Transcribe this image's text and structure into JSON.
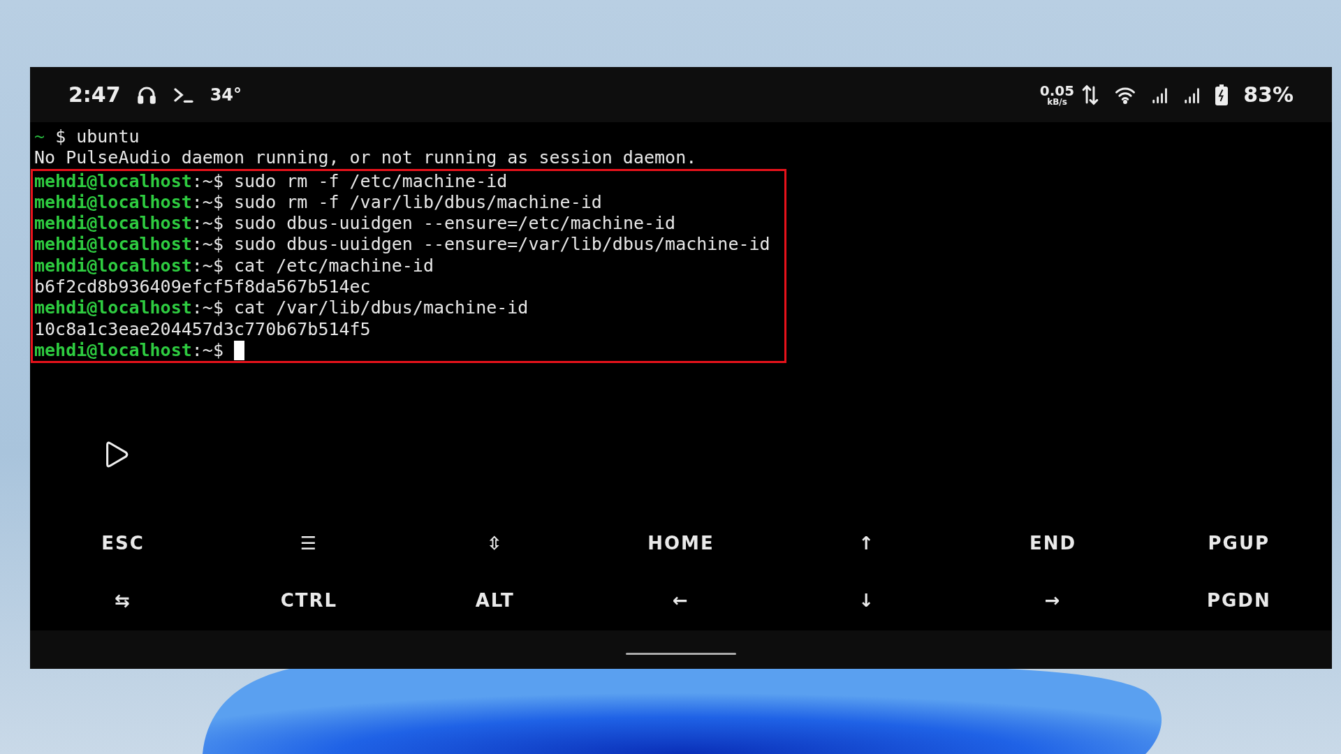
{
  "status_bar": {
    "time": "2:47",
    "temperature": "34°",
    "net_speed": "0.05",
    "net_unit": "kB/s",
    "battery": "83%"
  },
  "terminal": {
    "lines": [
      {
        "kind": "home",
        "path": "~",
        "symbol": "$",
        "command": "ubuntu"
      },
      {
        "kind": "output",
        "text": "No PulseAudio daemon running, or not running as session daemon."
      }
    ],
    "highlighted_block": {
      "lines": [
        {
          "kind": "prompt",
          "user": "mehdi@localhost",
          "path": ":~$",
          "command": "sudo rm -f /etc/machine-id"
        },
        {
          "kind": "prompt",
          "user": "mehdi@localhost",
          "path": ":~$",
          "command": "sudo rm -f /var/lib/dbus/machine-id"
        },
        {
          "kind": "prompt",
          "user": "mehdi@localhost",
          "path": ":~$",
          "command": "sudo dbus-uuidgen --ensure=/etc/machine-id"
        },
        {
          "kind": "prompt",
          "user": "mehdi@localhost",
          "path": ":~$",
          "command": "sudo dbus-uuidgen --ensure=/var/lib/dbus/machine-id"
        },
        {
          "kind": "prompt",
          "user": "mehdi@localhost",
          "path": ":~$",
          "command": "cat /etc/machine-id"
        },
        {
          "kind": "output",
          "text": "b6f2cd8b936409efcf5f8da567b514ec"
        },
        {
          "kind": "prompt",
          "user": "mehdi@localhost",
          "path": ":~$",
          "command": "cat /var/lib/dbus/machine-id"
        },
        {
          "kind": "output",
          "text": "10c8a1c3eae204457d3c770b67b514f5"
        },
        {
          "kind": "active_prompt",
          "user": "mehdi@localhost",
          "path": ":~$"
        }
      ]
    }
  },
  "extra_keys": [
    {
      "keys": [
        "ESC",
        "☰",
        "⇳",
        "HOME",
        "↑",
        "END",
        "PGUP"
      ]
    },
    {
      "keys": [
        "⇆",
        "CTRL",
        "ALT",
        "←",
        "↓",
        "→",
        "PGDN"
      ]
    }
  ]
}
